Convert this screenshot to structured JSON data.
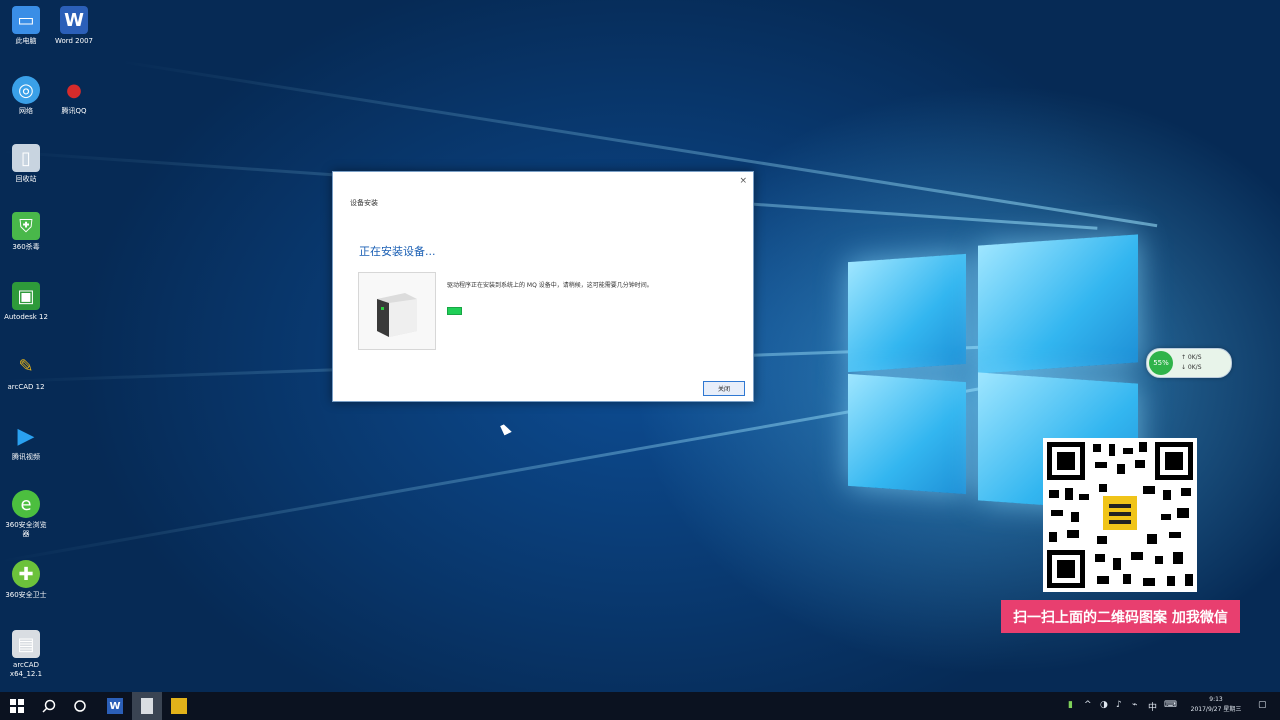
{
  "desktop_icons": [
    {
      "label": "此电脑",
      "icon": "computer-icon",
      "color": "#3a8ee6"
    },
    {
      "label": "Word 2007",
      "icon": "word-icon",
      "color": "#2b5fb8"
    },
    {
      "label": "网络",
      "icon": "network-icon",
      "color": "#3aa0e8"
    },
    {
      "label": "腾讯QQ",
      "icon": "qq-icon",
      "color": "#d62b2b"
    },
    {
      "label": "回收站",
      "icon": "recycle-bin-icon",
      "color": "#c8d4e0"
    },
    {
      "label": "360杀毒",
      "icon": "shield-icon",
      "color": "#49b84a"
    },
    {
      "label": "Autodesk 12",
      "icon": "autodesk-icon",
      "color": "#2e9a3a"
    },
    {
      "label": "arcCAD 12",
      "icon": "cad-icon",
      "color": "#e2b21a"
    },
    {
      "label": "腾讯视频",
      "icon": "video-player-icon",
      "color": "#2aa1f0"
    },
    {
      "label": "360安全浏览器",
      "icon": "browser-icon",
      "color": "#4cbf3f"
    },
    {
      "label": "360安全卫士",
      "icon": "guard-icon",
      "color": "#6cc23b"
    },
    {
      "label": "arcCAD x64_12.1",
      "icon": "installer-icon",
      "color": "#d9dde2"
    }
  ],
  "dialog": {
    "title": "设备安装",
    "close_glyph": "×",
    "heading": "正在安装设备...",
    "message": "驱动程序正在安装到系统上的 MQ 设备中，请稍候，这可能需要几分钟时间。",
    "progress": 0.05,
    "close_button": "关闭"
  },
  "net_widget": {
    "percent": "55%",
    "up": "↑ 0K/S",
    "down": "↓ 0K/S"
  },
  "promo_banner": "扫一扫上面的二维码图案  加我微信",
  "taskbar": {
    "start_icon": "windows-start-icon",
    "search_icon": "search-icon",
    "task_view_icon": "task-view-icon",
    "time": "9:13",
    "date": "2017/9/27 星期三"
  },
  "colors": {
    "accent": "#1a5fb4",
    "banner": "#e83f6f",
    "progress": "#1fcf57"
  }
}
